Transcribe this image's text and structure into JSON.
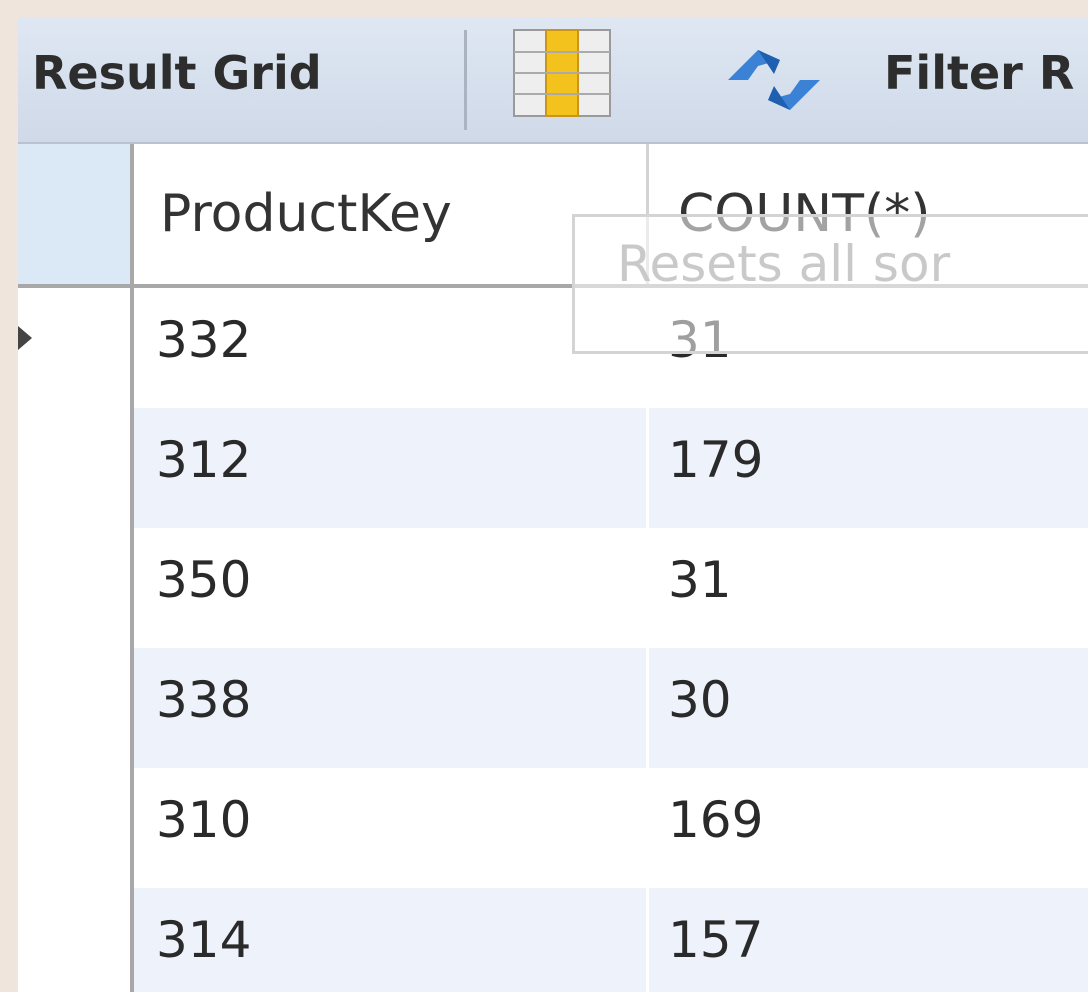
{
  "toolbar": {
    "title": "Result Grid",
    "filter_label": "Filter R"
  },
  "columns": [
    "ProductKey",
    "COUNT(*)"
  ],
  "rows": [
    {
      "ProductKey": "332",
      "COUNT": "31"
    },
    {
      "ProductKey": "312",
      "COUNT": "179"
    },
    {
      "ProductKey": "350",
      "COUNT": "31"
    },
    {
      "ProductKey": "338",
      "COUNT": "30"
    },
    {
      "ProductKey": "310",
      "COUNT": "169"
    },
    {
      "ProductKey": "314",
      "COUNT": "157"
    }
  ],
  "tooltip": {
    "text": "Resets all sor"
  },
  "icons": {
    "grid": "column-toggle-icon",
    "refresh": "refresh-icon"
  },
  "colors": {
    "toolbar_bg": "#d5deeb",
    "alt_row": "#eef2fb",
    "corner": "#dbe8f6"
  }
}
